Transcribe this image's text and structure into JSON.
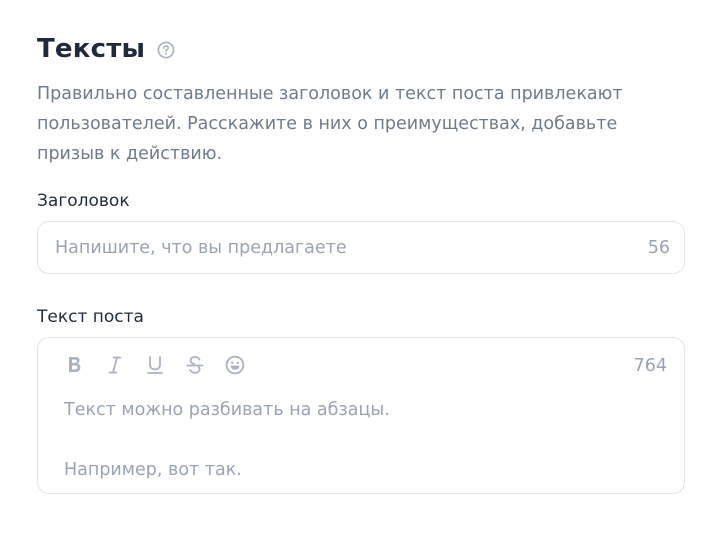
{
  "section": {
    "title": "Тексты",
    "description": "Правильно составленные заголовок и текст поста привлекают пользователей. Расскажите в них о преимуществах, добавьте призыв к действию."
  },
  "headline_field": {
    "label": "Заголовок",
    "placeholder": "Напишите, что вы предлагаете",
    "counter": "56"
  },
  "post_field": {
    "label": "Текст поста",
    "counter": "764",
    "placeholder_line1": "Текст можно разбивать на абзацы.",
    "placeholder_line2": "Например, вот так.",
    "toolbar": [
      "bold-icon",
      "italic-icon",
      "underline-icon",
      "strikethrough-icon",
      "emoji-icon"
    ]
  },
  "colors": {
    "title": "#1f2a3c",
    "text_muted": "#6f7a8b",
    "placeholder": "#9aa3b2",
    "icon": "#aab2c0",
    "border": "#dfe3ea"
  }
}
